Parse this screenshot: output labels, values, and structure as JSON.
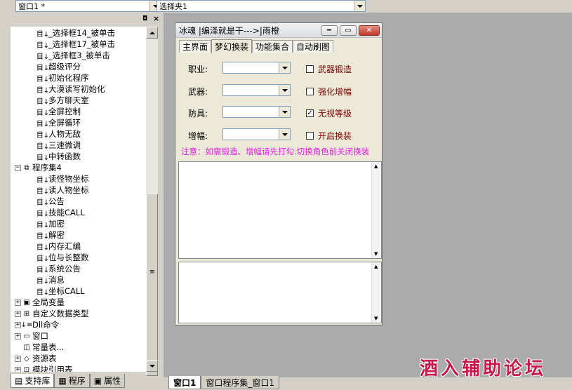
{
  "toolbar": {
    "window_combo": "窗口1 *",
    "control_combo": "选择夹1"
  },
  "tree": {
    "items": [
      {
        "label": "_选择框14_被单击",
        "level": 3,
        "type": "sub"
      },
      {
        "label": "_选择框17_被单击",
        "level": 3,
        "type": "sub"
      },
      {
        "label": "_选择框3_被单击",
        "level": 3,
        "type": "sub"
      },
      {
        "label": "超级评分",
        "level": 3,
        "type": "sub"
      },
      {
        "label": "初始化程序",
        "level": 3,
        "type": "sub"
      },
      {
        "label": "大漠读写初始化",
        "level": 3,
        "type": "sub"
      },
      {
        "label": "多方聊天室",
        "level": 3,
        "type": "sub"
      },
      {
        "label": "全屏控制",
        "level": 3,
        "type": "sub"
      },
      {
        "label": "全屏循环",
        "level": 3,
        "type": "sub"
      },
      {
        "label": "人物无敌",
        "level": 3,
        "type": "sub"
      },
      {
        "label": "三速微调",
        "level": 3,
        "type": "sub"
      },
      {
        "label": "中转函数",
        "level": 3,
        "type": "sub"
      },
      {
        "label": "程序集4",
        "level": 2,
        "type": "module",
        "expander": "−"
      },
      {
        "label": "读怪物坐标",
        "level": 3,
        "type": "sub"
      },
      {
        "label": "读人物坐标",
        "level": 3,
        "type": "sub"
      },
      {
        "label": "公告",
        "level": 3,
        "type": "sub"
      },
      {
        "label": "技能CALL",
        "level": 3,
        "type": "sub"
      },
      {
        "label": "加密",
        "level": 3,
        "type": "sub"
      },
      {
        "label": "解密",
        "level": 3,
        "type": "sub"
      },
      {
        "label": "内存汇编",
        "level": 3,
        "type": "sub"
      },
      {
        "label": "位与长整数",
        "level": 3,
        "type": "sub"
      },
      {
        "label": "系统公告",
        "level": 3,
        "type": "sub"
      },
      {
        "label": "消息",
        "level": 3,
        "type": "sub"
      },
      {
        "label": "坐标CALL",
        "level": 3,
        "type": "sub"
      },
      {
        "label": "全局变量",
        "level": 1,
        "type": "global",
        "expander": "+"
      },
      {
        "label": "自定义数据类型",
        "level": 1,
        "type": "datatype",
        "expander": "+"
      },
      {
        "label": "Dll命令",
        "level": 1,
        "type": "dll",
        "expander": "+"
      },
      {
        "label": "窗口",
        "level": 1,
        "type": "window",
        "expander": "+"
      },
      {
        "label": "常量表...",
        "level": 1,
        "type": "const"
      },
      {
        "label": "资源表",
        "level": 1,
        "type": "resource",
        "expander": "+"
      },
      {
        "label": "模块引用表",
        "level": 1,
        "type": "module-ref",
        "expander": "+"
      }
    ]
  },
  "left_tabs": [
    {
      "label": "支持库",
      "icon": "library-icon"
    },
    {
      "label": "程序",
      "icon": "program-icon"
    },
    {
      "label": "属性",
      "icon": "properties-icon"
    }
  ],
  "dialog": {
    "title": "冰魂 |编泽就是干--->|雨橙",
    "tabs": [
      "主界面",
      "梦幻换装",
      "功能集合",
      "自动刷图"
    ],
    "active_tab": 1,
    "rows": [
      {
        "label": "职业:",
        "value": "",
        "checkbox": "武器锻造",
        "checked": false
      },
      {
        "label": "武器:",
        "value": "",
        "checkbox": "强化增幅",
        "checked": false
      },
      {
        "label": "防具:",
        "value": "",
        "checkbox": "无视等级",
        "checked": true
      },
      {
        "label": "增幅:",
        "value": "",
        "checkbox": "开启换装",
        "checked": false
      }
    ],
    "notice": "注意：如需锻造、增幅请先打勾.切换角色前关闭换装",
    "notice_color": "#e020e0"
  },
  "mdi_tabs": [
    "窗口1",
    "窗口程序集_窗口1"
  ],
  "watermark": "酒入辅助论坛"
}
